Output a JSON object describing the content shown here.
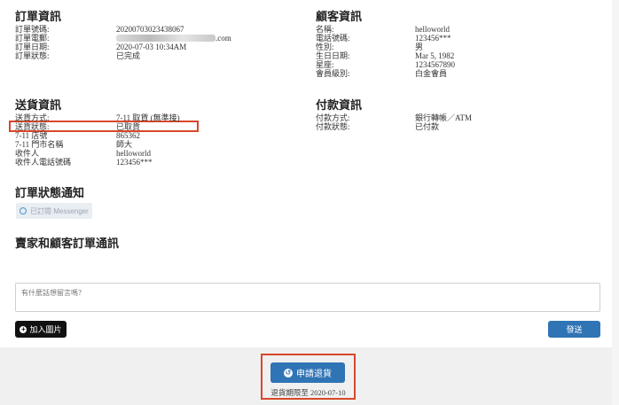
{
  "order_info": {
    "title": "訂單資訊",
    "rows": [
      {
        "label": "訂單號碼:",
        "value": "20200703023438067"
      },
      {
        "label": "訂單電郵:",
        "value": ".com"
      },
      {
        "label": "訂單日期:",
        "value": "2020-07-03 10:34AM"
      },
      {
        "label": "訂單狀態:",
        "value": "已完成"
      }
    ]
  },
  "customer_info": {
    "title": "顧客資訊",
    "rows": [
      {
        "label": "名稱:",
        "value": "helloworld"
      },
      {
        "label": "電話號碼:",
        "value": "123456***"
      },
      {
        "label": "性別:",
        "value": "男"
      },
      {
        "label": "生日日期:",
        "value": "Mar 5, 1982"
      },
      {
        "label": "星座:",
        "value": "1234567890"
      },
      {
        "label": "會員級別:",
        "value": "白金會員"
      }
    ]
  },
  "delivery_info": {
    "title": "送貨資訊",
    "rows": [
      {
        "label": "送貨方式:",
        "value": "7-11 取貨 (無準接)"
      },
      {
        "label": "送貨狀態:",
        "value": "已取貨"
      },
      {
        "label": "7-11 店號",
        "value": "865362"
      },
      {
        "label": "7-11 門市名稱",
        "value": "師大"
      },
      {
        "label": "收件人",
        "value": "helloworld"
      },
      {
        "label": "收件人電話號碼",
        "value": "123456***"
      }
    ]
  },
  "payment_info": {
    "title": "付款資訊",
    "rows": [
      {
        "label": "付款方式:",
        "value": "銀行轉帳／ATM"
      },
      {
        "label": "付款狀態:",
        "value": "已付款"
      }
    ]
  },
  "notify": {
    "title": "訂單狀態通知",
    "badge": "已訂閱 Messenger"
  },
  "chat": {
    "title": "賣家和顧客訂單通訊",
    "placeholder": "有什麼話想留言嗎？",
    "add_image": "加入圖片",
    "send": "發送"
  },
  "return": {
    "button": "申請退貨",
    "deadline": "退貨期限至 2020-07-10"
  },
  "colors": {
    "accent": "#2f74b5",
    "highlight": "#d8472b"
  }
}
